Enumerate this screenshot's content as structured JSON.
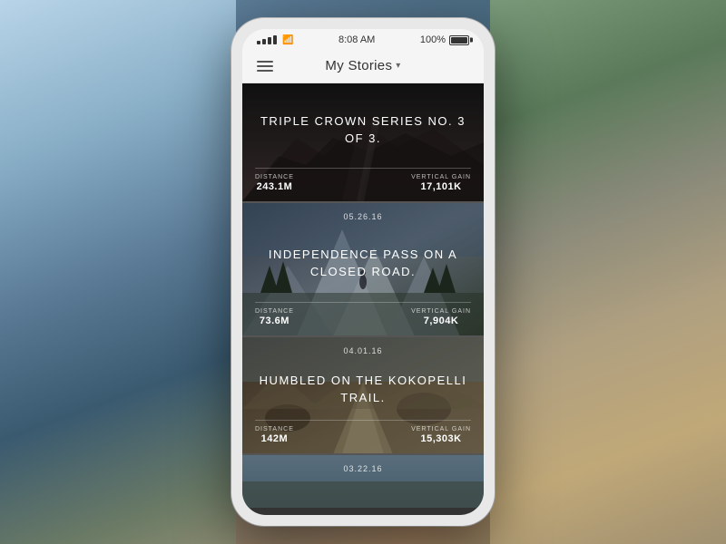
{
  "background": {
    "description": "mountain road landscape"
  },
  "phone": {
    "status_bar": {
      "time": "8:08 AM",
      "battery": "100%"
    },
    "nav": {
      "menu_label": "menu",
      "title": "My Stories",
      "dropdown_arrow": "▾"
    },
    "stories": [
      {
        "id": 1,
        "date": "",
        "title": "TRIPLE CROWN SERIES NO. 3 OF 3.",
        "stats": [
          {
            "label": "DISTANCE",
            "value": "243.1M"
          },
          {
            "label": "VERTICAL GAIN",
            "value": "17,101K"
          }
        ]
      },
      {
        "id": 2,
        "date": "05.26.16",
        "title": "INDEPENDENCE PASS ON A CLOSED ROAD.",
        "stats": [
          {
            "label": "DISTANCE",
            "value": "73.6M"
          },
          {
            "label": "VERTICAL GAIN",
            "value": "7,904K"
          }
        ]
      },
      {
        "id": 3,
        "date": "04.01.16",
        "title": "HUMBLED ON THE KOKOPELLI TRAIL.",
        "stats": [
          {
            "label": "DISTANCE",
            "value": "142M"
          },
          {
            "label": "VERTICAL GAIN",
            "value": "15,303K"
          }
        ]
      },
      {
        "id": 4,
        "date": "03.22.16",
        "title": "",
        "stats": []
      }
    ]
  }
}
